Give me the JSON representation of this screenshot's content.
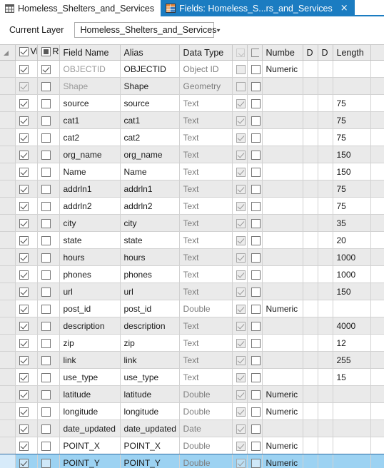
{
  "tabs": [
    {
      "label": "Homeless_Shelters_and_Services",
      "icon": "table-grid-icon",
      "active": false,
      "closable": false
    },
    {
      "label": "Fields:  Homeless_S...rs_and_Services",
      "icon": "fields-table-icon",
      "active": true,
      "closable": true,
      "close_glyph": "×"
    }
  ],
  "toolbar": {
    "current_layer_label": "Current Layer",
    "layer_value": "Homeless_Shelters_and_Services",
    "caret_glyph": "▾"
  },
  "grid": {
    "columns": [
      {
        "key": "sel",
        "label": "",
        "type": "corner"
      },
      {
        "key": "vis",
        "label": "Vi",
        "type": "checkbox-header"
      },
      {
        "key": "ro",
        "label": "R",
        "type": "checkbox-header"
      },
      {
        "key": "name",
        "label": "Field Name",
        "type": "text"
      },
      {
        "key": "alias",
        "label": "Alias",
        "type": "text"
      },
      {
        "key": "type",
        "label": "Data Type",
        "type": "text"
      },
      {
        "key": "cb1",
        "label": "",
        "type": "glyph-faint"
      },
      {
        "key": "cb2",
        "label": "",
        "type": "glyph-clip"
      },
      {
        "key": "numb",
        "label": "Numbe",
        "type": "text"
      },
      {
        "key": "d1",
        "label": "D",
        "type": "text"
      },
      {
        "key": "d2",
        "label": "D",
        "type": "text"
      },
      {
        "key": "len",
        "label": "Length",
        "type": "text"
      },
      {
        "key": "tail",
        "label": "",
        "type": "text"
      }
    ],
    "rows": [
      {
        "visible": true,
        "visible_enabled": true,
        "readonly": true,
        "readonly_enabled": true,
        "name": "OBJECTID",
        "name_dim": true,
        "alias": "OBJECTID",
        "type": "Object ID",
        "allow_null": false,
        "allow_null_enabled": false,
        "null2": false,
        "number_format": "Numeric",
        "d1": "",
        "d2": "",
        "length": "",
        "selected": false
      },
      {
        "visible": true,
        "visible_enabled": false,
        "readonly": false,
        "readonly_enabled": true,
        "name": "Shape",
        "name_dim": true,
        "alias": "Shape",
        "type": "Geometry",
        "allow_null": false,
        "allow_null_enabled": false,
        "null2": false,
        "number_format": "",
        "d1": "",
        "d2": "",
        "length": "",
        "selected": false
      },
      {
        "visible": true,
        "visible_enabled": true,
        "readonly": false,
        "readonly_enabled": true,
        "name": "source",
        "name_dim": false,
        "alias": "source",
        "type": "Text",
        "allow_null": true,
        "allow_null_enabled": false,
        "null2": false,
        "number_format": "",
        "d1": "",
        "d2": "",
        "length": "75",
        "selected": false
      },
      {
        "visible": true,
        "visible_enabled": true,
        "readonly": false,
        "readonly_enabled": true,
        "name": "cat1",
        "name_dim": false,
        "alias": "cat1",
        "type": "Text",
        "allow_null": true,
        "allow_null_enabled": false,
        "null2": false,
        "number_format": "",
        "d1": "",
        "d2": "",
        "length": "75",
        "selected": false
      },
      {
        "visible": true,
        "visible_enabled": true,
        "readonly": false,
        "readonly_enabled": true,
        "name": "cat2",
        "name_dim": false,
        "alias": "cat2",
        "type": "Text",
        "allow_null": true,
        "allow_null_enabled": false,
        "null2": false,
        "number_format": "",
        "d1": "",
        "d2": "",
        "length": "75",
        "selected": false
      },
      {
        "visible": true,
        "visible_enabled": true,
        "readonly": false,
        "readonly_enabled": true,
        "name": "org_name",
        "name_dim": false,
        "alias": "org_name",
        "type": "Text",
        "allow_null": true,
        "allow_null_enabled": false,
        "null2": false,
        "number_format": "",
        "d1": "",
        "d2": "",
        "length": "150",
        "selected": false
      },
      {
        "visible": true,
        "visible_enabled": true,
        "readonly": false,
        "readonly_enabled": true,
        "name": "Name",
        "name_dim": false,
        "alias": "Name",
        "type": "Text",
        "allow_null": true,
        "allow_null_enabled": false,
        "null2": false,
        "number_format": "",
        "d1": "",
        "d2": "",
        "length": "150",
        "selected": false
      },
      {
        "visible": true,
        "visible_enabled": true,
        "readonly": false,
        "readonly_enabled": true,
        "name": "addrln1",
        "name_dim": false,
        "alias": "addrln1",
        "type": "Text",
        "allow_null": true,
        "allow_null_enabled": false,
        "null2": false,
        "number_format": "",
        "d1": "",
        "d2": "",
        "length": "75",
        "selected": false
      },
      {
        "visible": true,
        "visible_enabled": true,
        "readonly": false,
        "readonly_enabled": true,
        "name": "addrln2",
        "name_dim": false,
        "alias": "addrln2",
        "type": "Text",
        "allow_null": true,
        "allow_null_enabled": false,
        "null2": false,
        "number_format": "",
        "d1": "",
        "d2": "",
        "length": "75",
        "selected": false
      },
      {
        "visible": true,
        "visible_enabled": true,
        "readonly": false,
        "readonly_enabled": true,
        "name": "city",
        "name_dim": false,
        "alias": "city",
        "type": "Text",
        "allow_null": true,
        "allow_null_enabled": false,
        "null2": false,
        "number_format": "",
        "d1": "",
        "d2": "",
        "length": "35",
        "selected": false
      },
      {
        "visible": true,
        "visible_enabled": true,
        "readonly": false,
        "readonly_enabled": true,
        "name": "state",
        "name_dim": false,
        "alias": "state",
        "type": "Text",
        "allow_null": true,
        "allow_null_enabled": false,
        "null2": false,
        "number_format": "",
        "d1": "",
        "d2": "",
        "length": "20",
        "selected": false
      },
      {
        "visible": true,
        "visible_enabled": true,
        "readonly": false,
        "readonly_enabled": true,
        "name": "hours",
        "name_dim": false,
        "alias": "hours",
        "type": "Text",
        "allow_null": true,
        "allow_null_enabled": false,
        "null2": false,
        "number_format": "",
        "d1": "",
        "d2": "",
        "length": "1000",
        "selected": false
      },
      {
        "visible": true,
        "visible_enabled": true,
        "readonly": false,
        "readonly_enabled": true,
        "name": "phones",
        "name_dim": false,
        "alias": "phones",
        "type": "Text",
        "allow_null": true,
        "allow_null_enabled": false,
        "null2": false,
        "number_format": "",
        "d1": "",
        "d2": "",
        "length": "1000",
        "selected": false
      },
      {
        "visible": true,
        "visible_enabled": true,
        "readonly": false,
        "readonly_enabled": true,
        "name": "url",
        "name_dim": false,
        "alias": "url",
        "type": "Text",
        "allow_null": true,
        "allow_null_enabled": false,
        "null2": false,
        "number_format": "",
        "d1": "",
        "d2": "",
        "length": "150",
        "selected": false
      },
      {
        "visible": true,
        "visible_enabled": true,
        "readonly": false,
        "readonly_enabled": true,
        "name": "post_id",
        "name_dim": false,
        "alias": "post_id",
        "type": "Double",
        "allow_null": true,
        "allow_null_enabled": false,
        "null2": false,
        "number_format": "Numeric",
        "d1": "",
        "d2": "",
        "length": "",
        "selected": false
      },
      {
        "visible": true,
        "visible_enabled": true,
        "readonly": false,
        "readonly_enabled": true,
        "name": "description",
        "name_dim": false,
        "alias": "description",
        "type": "Text",
        "allow_null": true,
        "allow_null_enabled": false,
        "null2": false,
        "number_format": "",
        "d1": "",
        "d2": "",
        "length": "4000",
        "selected": false
      },
      {
        "visible": true,
        "visible_enabled": true,
        "readonly": false,
        "readonly_enabled": true,
        "name": "zip",
        "name_dim": false,
        "alias": "zip",
        "type": "Text",
        "allow_null": true,
        "allow_null_enabled": false,
        "null2": false,
        "number_format": "",
        "d1": "",
        "d2": "",
        "length": "12",
        "selected": false
      },
      {
        "visible": true,
        "visible_enabled": true,
        "readonly": false,
        "readonly_enabled": true,
        "name": "link",
        "name_dim": false,
        "alias": "link",
        "type": "Text",
        "allow_null": true,
        "allow_null_enabled": false,
        "null2": false,
        "number_format": "",
        "d1": "",
        "d2": "",
        "length": "255",
        "selected": false
      },
      {
        "visible": true,
        "visible_enabled": true,
        "readonly": false,
        "readonly_enabled": true,
        "name": "use_type",
        "name_dim": false,
        "alias": "use_type",
        "type": "Text",
        "allow_null": true,
        "allow_null_enabled": false,
        "null2": false,
        "number_format": "",
        "d1": "",
        "d2": "",
        "length": "15",
        "selected": false
      },
      {
        "visible": true,
        "visible_enabled": true,
        "readonly": false,
        "readonly_enabled": true,
        "name": "latitude",
        "name_dim": false,
        "alias": "latitude",
        "type": "Double",
        "allow_null": true,
        "allow_null_enabled": false,
        "null2": false,
        "number_format": "Numeric",
        "d1": "",
        "d2": "",
        "length": "",
        "selected": false
      },
      {
        "visible": true,
        "visible_enabled": true,
        "readonly": false,
        "readonly_enabled": true,
        "name": "longitude",
        "name_dim": false,
        "alias": "longitude",
        "type": "Double",
        "allow_null": true,
        "allow_null_enabled": false,
        "null2": false,
        "number_format": "Numeric",
        "d1": "",
        "d2": "",
        "length": "",
        "selected": false
      },
      {
        "visible": true,
        "visible_enabled": true,
        "readonly": false,
        "readonly_enabled": true,
        "name": "date_updated",
        "name_dim": false,
        "alias": "date_updated",
        "type": "Date",
        "allow_null": true,
        "allow_null_enabled": false,
        "null2": false,
        "number_format": "",
        "d1": "",
        "d2": "",
        "length": "",
        "selected": false
      },
      {
        "visible": true,
        "visible_enabled": true,
        "readonly": false,
        "readonly_enabled": true,
        "name": "POINT_X",
        "name_dim": false,
        "alias": "POINT_X",
        "type": "Double",
        "allow_null": true,
        "allow_null_enabled": false,
        "null2": false,
        "number_format": "Numeric",
        "d1": "",
        "d2": "",
        "length": "",
        "selected": false
      },
      {
        "visible": true,
        "visible_enabled": true,
        "readonly": false,
        "readonly_enabled": true,
        "name": "POINT_Y",
        "name_dim": false,
        "alias": "POINT_Y",
        "type": "Double",
        "allow_null": true,
        "allow_null_enabled": false,
        "null2": false,
        "number_format": "Numeric",
        "d1": "",
        "d2": "",
        "length": "",
        "selected": true
      }
    ]
  },
  "colors": {
    "accent": "#1b7cc1",
    "selection": "#9cd2f2",
    "header_bg": "#eaeaea",
    "row_alt_bg": "#eaeaea",
    "grid_line": "#d2d2d2"
  }
}
